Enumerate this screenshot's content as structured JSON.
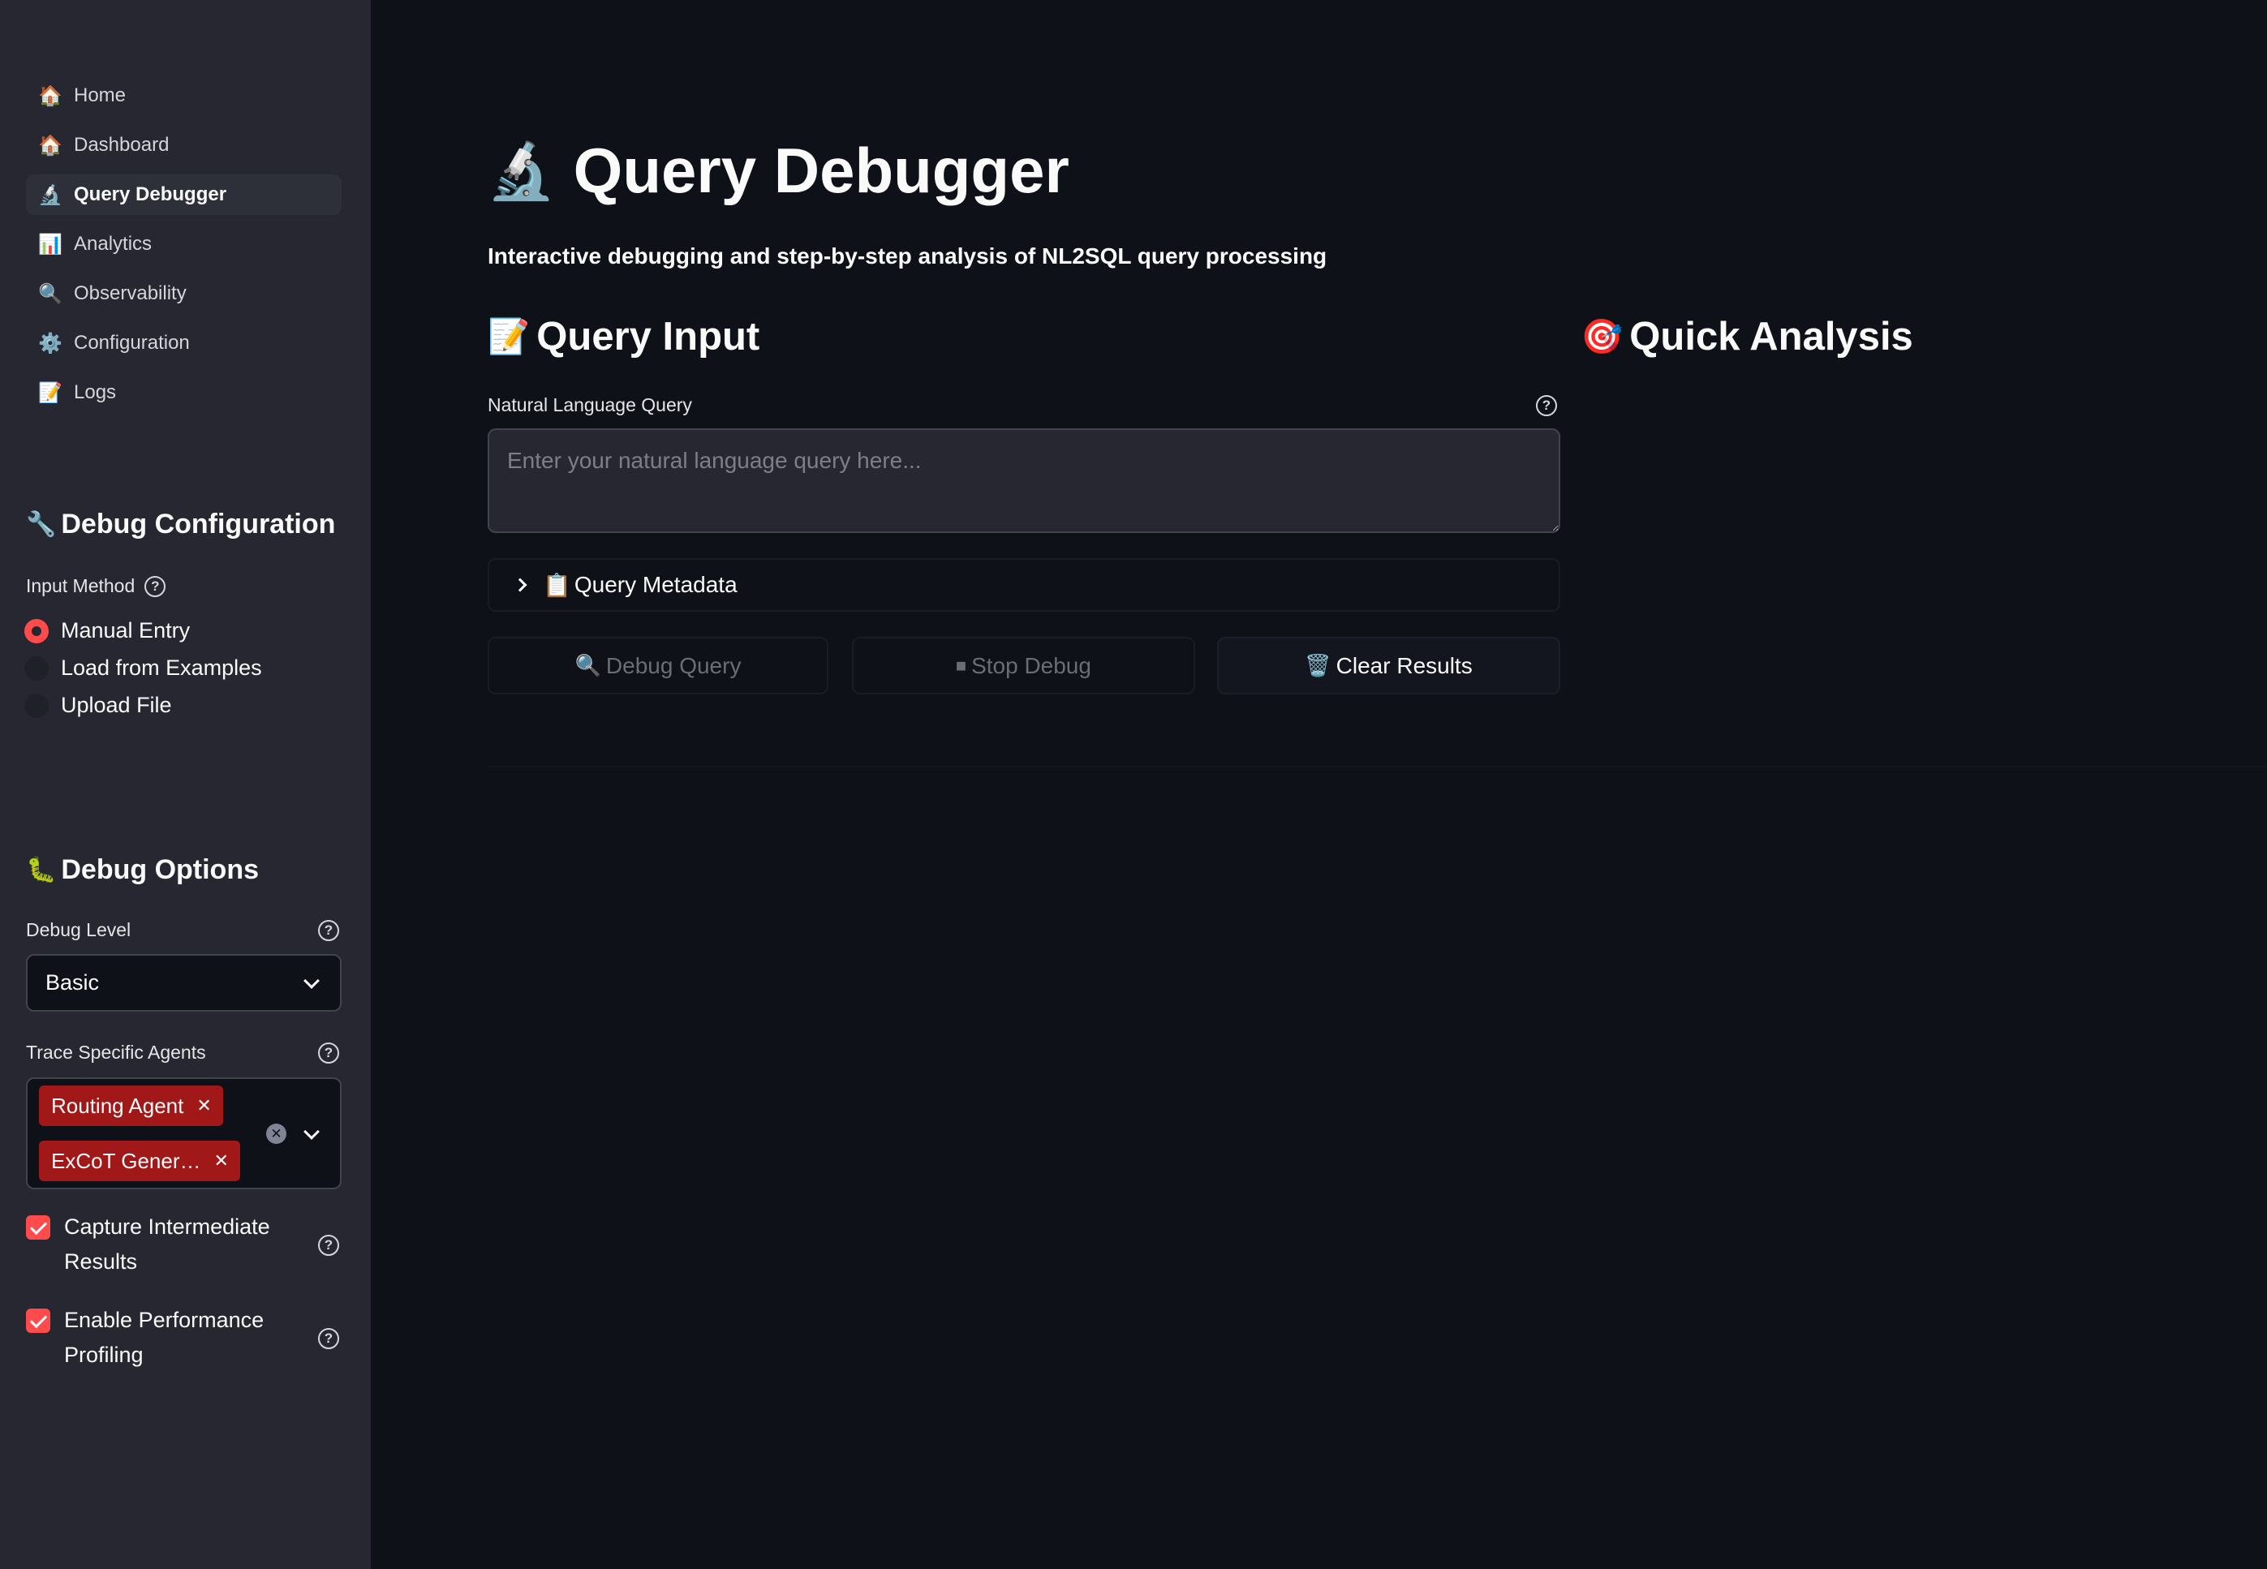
{
  "sidebar": {
    "nav": [
      {
        "icon": "🏠",
        "icon_name": "home-icon",
        "label": "Home"
      },
      {
        "icon": "🏠",
        "icon_name": "dashboard-icon",
        "label": "Dashboard"
      },
      {
        "icon": "🔬",
        "icon_name": "microscope-icon",
        "label": "Query Debugger",
        "active": true
      },
      {
        "icon": "📊",
        "icon_name": "bar-chart-icon",
        "label": "Analytics"
      },
      {
        "icon": "🔍",
        "icon_name": "magnifier-icon",
        "label": "Observability"
      },
      {
        "icon": "⚙️",
        "icon_name": "gear-icon",
        "label": "Configuration"
      },
      {
        "icon": "📝",
        "icon_name": "memo-icon",
        "label": "Logs"
      }
    ],
    "debug_config": {
      "icon": "🔧",
      "heading": "Debug Configuration",
      "input_method_label": "Input Method",
      "options": [
        "Manual Entry",
        "Load from Examples",
        "Upload File"
      ],
      "selected": "Manual Entry"
    },
    "debug_options": {
      "icon": "🐛",
      "heading": "Debug Options",
      "debug_level_label": "Debug Level",
      "debug_level_value": "Basic",
      "trace_label": "Trace Specific Agents",
      "trace_agents": [
        "Routing Agent",
        "ExCoT Gener…"
      ],
      "capture_label": "Capture Intermediate Results",
      "capture_checked": true,
      "profiling_label": "Enable Performance Profiling",
      "profiling_checked": true
    }
  },
  "main": {
    "title_icon": "🔬",
    "title": "Query Debugger",
    "subtitle": "Interactive debugging and step-by-step analysis of NL2SQL query processing",
    "query_input": {
      "icon": "📝",
      "heading": "Query Input",
      "nl_label": "Natural Language Query",
      "placeholder": "Enter your natural language query here...",
      "value": ""
    },
    "quick_analysis": {
      "icon": "🎯",
      "heading": "Quick Analysis"
    },
    "metadata": {
      "icon": "📋",
      "label": "Query Metadata"
    },
    "buttons": {
      "debug": {
        "icon": "🔍",
        "label": "Debug Query"
      },
      "stop": {
        "icon": "⏹",
        "label": "Stop Debug"
      },
      "clear": {
        "icon": "🗑️",
        "label": "Clear Results"
      }
    }
  },
  "colors": {
    "accent": "#ff4b4b",
    "tag": "#a01818",
    "background": "#0e1117",
    "sidebar": "#262730"
  }
}
